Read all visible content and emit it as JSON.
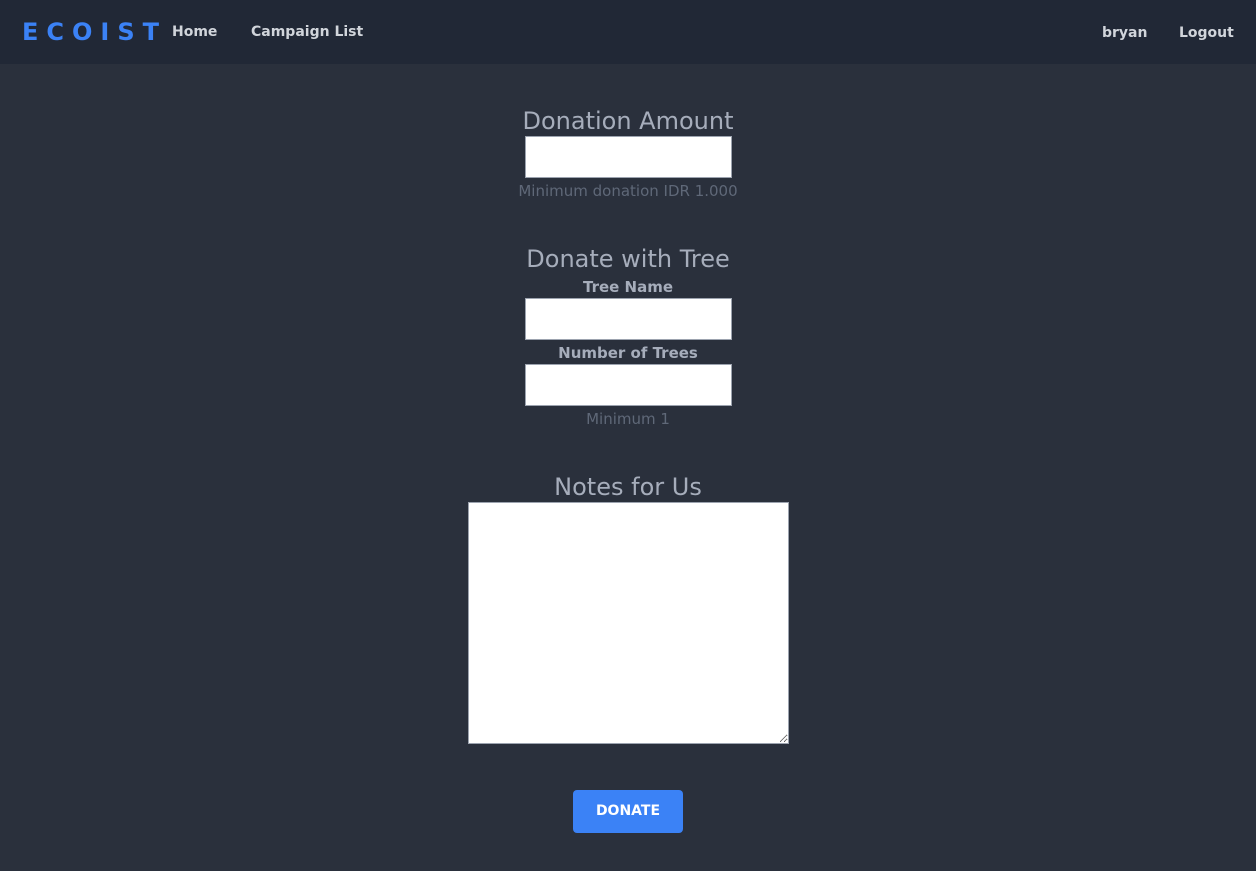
{
  "nav": {
    "brand": "ECOIST",
    "links": [
      "Home",
      "Campaign List"
    ],
    "user": "bryan",
    "logout": "Logout"
  },
  "donation": {
    "title": "Donation Amount",
    "amount_value": "",
    "hint": "Minimum donation IDR 1.000"
  },
  "tree": {
    "title": "Donate with Tree",
    "name_label": "Tree Name",
    "name_value": "",
    "count_label": "Number of Trees",
    "count_value": "",
    "hint": "Minimum 1"
  },
  "notes": {
    "title": "Notes for Us",
    "value": ""
  },
  "donate_button": "DONATE",
  "colors": {
    "accent": "#3b82f6",
    "background": "#2a303c",
    "navbar": "#212836"
  }
}
